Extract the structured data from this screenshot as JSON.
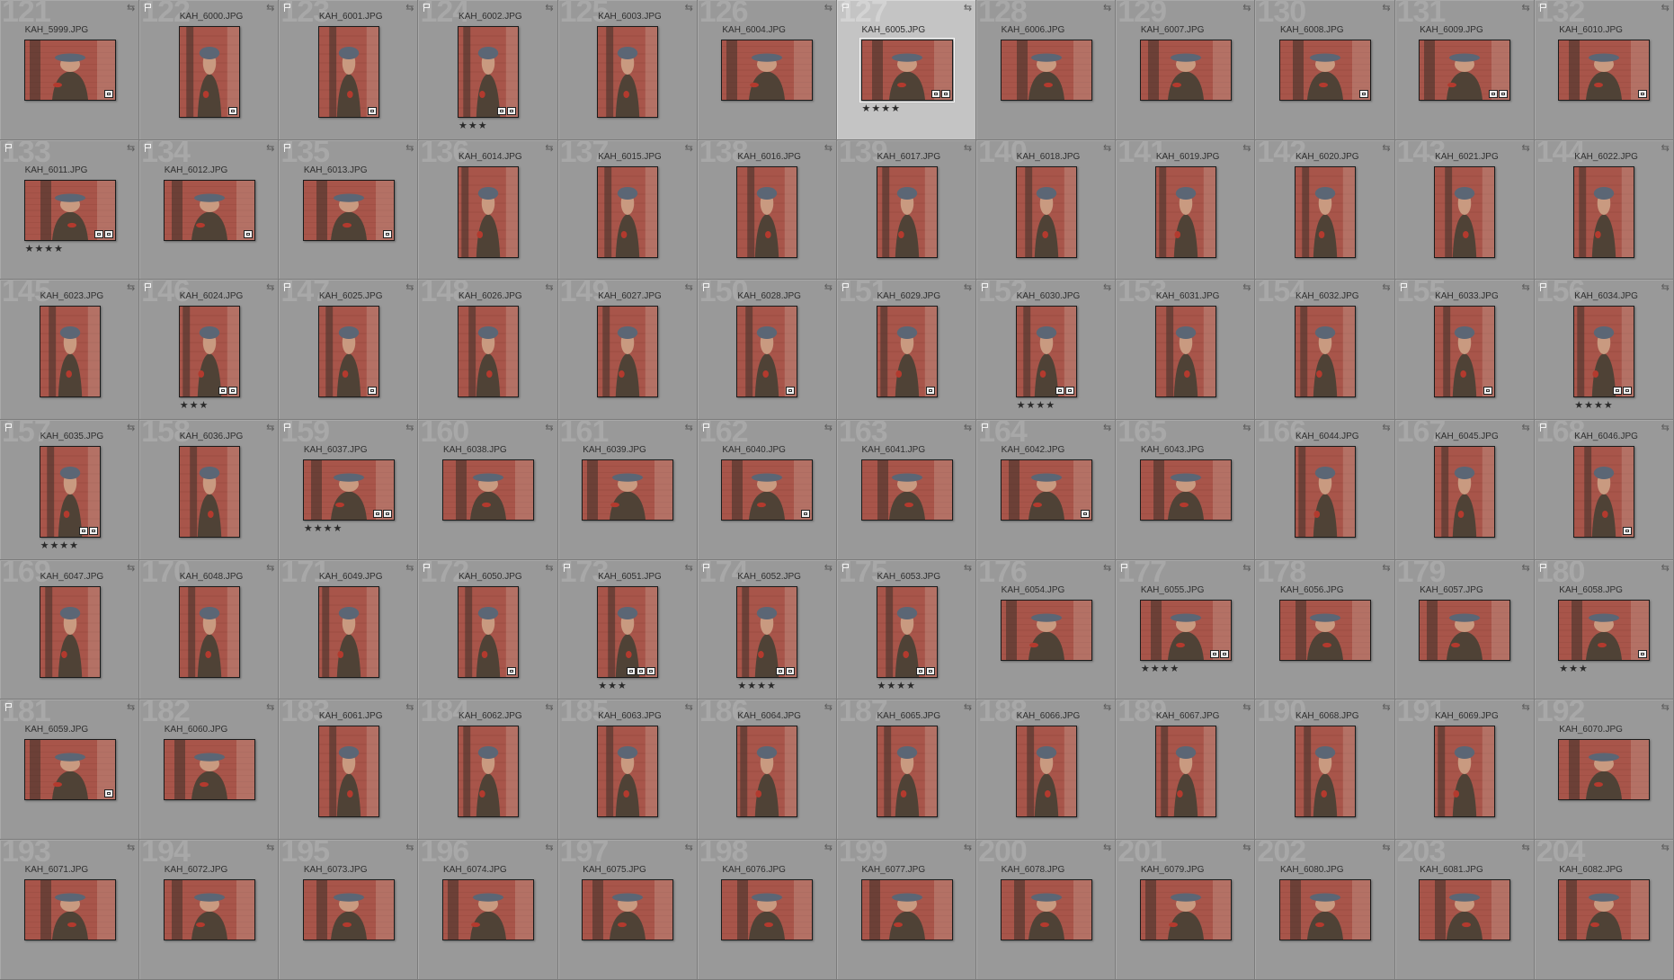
{
  "grid": {
    "cells": [
      {
        "index": "121",
        "filename": "KAH_5999.JPG",
        "flagged": false,
        "orientation": "landscape",
        "stars": "",
        "badges": 1,
        "selected": false
      },
      {
        "index": "122",
        "filename": "KAH_6000.JPG",
        "flagged": true,
        "orientation": "portrait",
        "stars": "",
        "badges": 1,
        "selected": false
      },
      {
        "index": "123",
        "filename": "KAH_6001.JPG",
        "flagged": true,
        "orientation": "portrait",
        "stars": "",
        "badges": 1,
        "selected": false
      },
      {
        "index": "124",
        "filename": "KAH_6002.JPG",
        "flagged": true,
        "orientation": "portrait",
        "stars": "★★★",
        "badges": 2,
        "selected": false
      },
      {
        "index": "125",
        "filename": "KAH_6003.JPG",
        "flagged": false,
        "orientation": "portrait",
        "stars": "",
        "badges": 0,
        "selected": false
      },
      {
        "index": "126",
        "filename": "KAH_6004.JPG",
        "flagged": false,
        "orientation": "landscape",
        "stars": "",
        "badges": 0,
        "selected": false
      },
      {
        "index": "127",
        "filename": "KAH_6005.JPG",
        "flagged": true,
        "orientation": "landscape",
        "stars": "★★★★",
        "badges": 2,
        "selected": true
      },
      {
        "index": "128",
        "filename": "KAH_6006.JPG",
        "flagged": false,
        "orientation": "landscape",
        "stars": "",
        "badges": 0,
        "selected": false
      },
      {
        "index": "129",
        "filename": "KAH_6007.JPG",
        "flagged": false,
        "orientation": "landscape",
        "stars": "",
        "badges": 0,
        "selected": false
      },
      {
        "index": "130",
        "filename": "KAH_6008.JPG",
        "flagged": false,
        "orientation": "landscape",
        "stars": "",
        "badges": 1,
        "selected": false
      },
      {
        "index": "131",
        "filename": "KAH_6009.JPG",
        "flagged": false,
        "orientation": "landscape",
        "stars": "",
        "badges": 2,
        "selected": false
      },
      {
        "index": "132",
        "filename": "KAH_6010.JPG",
        "flagged": true,
        "orientation": "landscape",
        "stars": "",
        "badges": 1,
        "selected": false
      },
      {
        "index": "133",
        "filename": "KAH_6011.JPG",
        "flagged": true,
        "orientation": "landscape",
        "stars": "★★★★",
        "badges": 2,
        "selected": false
      },
      {
        "index": "134",
        "filename": "KAH_6012.JPG",
        "flagged": true,
        "orientation": "landscape",
        "stars": "",
        "badges": 1,
        "selected": false
      },
      {
        "index": "135",
        "filename": "KAH_6013.JPG",
        "flagged": true,
        "orientation": "landscape",
        "stars": "",
        "badges": 1,
        "selected": false
      },
      {
        "index": "136",
        "filename": "KAH_6014.JPG",
        "flagged": false,
        "orientation": "portrait",
        "stars": "",
        "badges": 0,
        "selected": false
      },
      {
        "index": "137",
        "filename": "KAH_6015.JPG",
        "flagged": false,
        "orientation": "portrait",
        "stars": "",
        "badges": 0,
        "selected": false
      },
      {
        "index": "138",
        "filename": "KAH_6016.JPG",
        "flagged": false,
        "orientation": "portrait",
        "stars": "",
        "badges": 0,
        "selected": false
      },
      {
        "index": "139",
        "filename": "KAH_6017.JPG",
        "flagged": false,
        "orientation": "portrait",
        "stars": "",
        "badges": 0,
        "selected": false
      },
      {
        "index": "140",
        "filename": "KAH_6018.JPG",
        "flagged": false,
        "orientation": "portrait",
        "stars": "",
        "badges": 0,
        "selected": false
      },
      {
        "index": "141",
        "filename": "KAH_6019.JPG",
        "flagged": false,
        "orientation": "portrait",
        "stars": "",
        "badges": 0,
        "selected": false
      },
      {
        "index": "142",
        "filename": "KAH_6020.JPG",
        "flagged": false,
        "orientation": "portrait",
        "stars": "",
        "badges": 0,
        "selected": false
      },
      {
        "index": "143",
        "filename": "KAH_6021.JPG",
        "flagged": false,
        "orientation": "portrait",
        "stars": "",
        "badges": 0,
        "selected": false
      },
      {
        "index": "144",
        "filename": "KAH_6022.JPG",
        "flagged": false,
        "orientation": "portrait",
        "stars": "",
        "badges": 0,
        "selected": false
      },
      {
        "index": "145",
        "filename": "KAH_6023.JPG",
        "flagged": false,
        "orientation": "portrait",
        "stars": "",
        "badges": 0,
        "selected": false
      },
      {
        "index": "146",
        "filename": "KAH_6024.JPG",
        "flagged": true,
        "orientation": "portrait",
        "stars": "★★★",
        "badges": 2,
        "selected": false
      },
      {
        "index": "147",
        "filename": "KAH_6025.JPG",
        "flagged": true,
        "orientation": "portrait",
        "stars": "",
        "badges": 1,
        "selected": false
      },
      {
        "index": "148",
        "filename": "KAH_6026.JPG",
        "flagged": false,
        "orientation": "portrait",
        "stars": "",
        "badges": 0,
        "selected": false
      },
      {
        "index": "149",
        "filename": "KAH_6027.JPG",
        "flagged": false,
        "orientation": "portrait",
        "stars": "",
        "badges": 0,
        "selected": false
      },
      {
        "index": "150",
        "filename": "KAH_6028.JPG",
        "flagged": true,
        "orientation": "portrait",
        "stars": "",
        "badges": 1,
        "selected": false
      },
      {
        "index": "151",
        "filename": "KAH_6029.JPG",
        "flagged": true,
        "orientation": "portrait",
        "stars": "",
        "badges": 1,
        "selected": false
      },
      {
        "index": "152",
        "filename": "KAH_6030.JPG",
        "flagged": true,
        "orientation": "portrait",
        "stars": "★★★★",
        "badges": 2,
        "selected": false
      },
      {
        "index": "153",
        "filename": "KAH_6031.JPG",
        "flagged": false,
        "orientation": "portrait",
        "stars": "",
        "badges": 0,
        "selected": false
      },
      {
        "index": "154",
        "filename": "KAH_6032.JPG",
        "flagged": false,
        "orientation": "portrait",
        "stars": "",
        "badges": 0,
        "selected": false
      },
      {
        "index": "155",
        "filename": "KAH_6033.JPG",
        "flagged": true,
        "orientation": "portrait",
        "stars": "",
        "badges": 1,
        "selected": false
      },
      {
        "index": "156",
        "filename": "KAH_6034.JPG",
        "flagged": true,
        "orientation": "portrait",
        "stars": "★★★★",
        "badges": 2,
        "selected": false
      },
      {
        "index": "157",
        "filename": "KAH_6035.JPG",
        "flagged": true,
        "orientation": "portrait",
        "stars": "★★★★",
        "badges": 2,
        "selected": false
      },
      {
        "index": "158",
        "filename": "KAH_6036.JPG",
        "flagged": false,
        "orientation": "portrait",
        "stars": "",
        "badges": 0,
        "selected": false
      },
      {
        "index": "159",
        "filename": "KAH_6037.JPG",
        "flagged": true,
        "orientation": "landscape",
        "stars": "★★★★",
        "badges": 2,
        "selected": false
      },
      {
        "index": "160",
        "filename": "KAH_6038.JPG",
        "flagged": false,
        "orientation": "landscape",
        "stars": "",
        "badges": 0,
        "selected": false
      },
      {
        "index": "161",
        "filename": "KAH_6039.JPG",
        "flagged": false,
        "orientation": "landscape",
        "stars": "",
        "badges": 0,
        "selected": false
      },
      {
        "index": "162",
        "filename": "KAH_6040.JPG",
        "flagged": true,
        "orientation": "landscape",
        "stars": "",
        "badges": 1,
        "selected": false
      },
      {
        "index": "163",
        "filename": "KAH_6041.JPG",
        "flagged": false,
        "orientation": "landscape",
        "stars": "",
        "badges": 0,
        "selected": false
      },
      {
        "index": "164",
        "filename": "KAH_6042.JPG",
        "flagged": true,
        "orientation": "landscape",
        "stars": "",
        "badges": 1,
        "selected": false
      },
      {
        "index": "165",
        "filename": "KAH_6043.JPG",
        "flagged": false,
        "orientation": "landscape",
        "stars": "",
        "badges": 0,
        "selected": false
      },
      {
        "index": "166",
        "filename": "KAH_6044.JPG",
        "flagged": false,
        "orientation": "portrait",
        "stars": "",
        "badges": 0,
        "selected": false
      },
      {
        "index": "167",
        "filename": "KAH_6045.JPG",
        "flagged": false,
        "orientation": "portrait",
        "stars": "",
        "badges": 0,
        "selected": false
      },
      {
        "index": "168",
        "filename": "KAH_6046.JPG",
        "flagged": true,
        "orientation": "portrait",
        "stars": "",
        "badges": 1,
        "selected": false
      },
      {
        "index": "169",
        "filename": "KAH_6047.JPG",
        "flagged": false,
        "orientation": "portrait",
        "stars": "",
        "badges": 0,
        "selected": false
      },
      {
        "index": "170",
        "filename": "KAH_6048.JPG",
        "flagged": false,
        "orientation": "portrait",
        "stars": "",
        "badges": 0,
        "selected": false
      },
      {
        "index": "171",
        "filename": "KAH_6049.JPG",
        "flagged": false,
        "orientation": "portrait",
        "stars": "",
        "badges": 0,
        "selected": false
      },
      {
        "index": "172",
        "filename": "KAH_6050.JPG",
        "flagged": true,
        "orientation": "portrait",
        "stars": "",
        "badges": 1,
        "selected": false
      },
      {
        "index": "173",
        "filename": "KAH_6051.JPG",
        "flagged": true,
        "orientation": "portrait",
        "stars": "★★★",
        "badges": 3,
        "selected": false
      },
      {
        "index": "174",
        "filename": "KAH_6052.JPG",
        "flagged": true,
        "orientation": "portrait",
        "stars": "★★★★",
        "badges": 2,
        "selected": false
      },
      {
        "index": "175",
        "filename": "KAH_6053.JPG",
        "flagged": true,
        "orientation": "portrait",
        "stars": "★★★★",
        "badges": 2,
        "selected": false
      },
      {
        "index": "176",
        "filename": "KAH_6054.JPG",
        "flagged": false,
        "orientation": "landscape",
        "stars": "",
        "badges": 0,
        "selected": false
      },
      {
        "index": "177",
        "filename": "KAH_6055.JPG",
        "flagged": true,
        "orientation": "landscape",
        "stars": "★★★★",
        "badges": 2,
        "selected": false
      },
      {
        "index": "178",
        "filename": "KAH_6056.JPG",
        "flagged": false,
        "orientation": "landscape",
        "stars": "",
        "badges": 0,
        "selected": false
      },
      {
        "index": "179",
        "filename": "KAH_6057.JPG",
        "flagged": false,
        "orientation": "landscape",
        "stars": "",
        "badges": 0,
        "selected": false
      },
      {
        "index": "180",
        "filename": "KAH_6058.JPG",
        "flagged": true,
        "orientation": "landscape",
        "stars": "★★★",
        "badges": 1,
        "selected": false
      },
      {
        "index": "181",
        "filename": "KAH_6059.JPG",
        "flagged": true,
        "orientation": "landscape",
        "stars": "",
        "badges": 1,
        "selected": false
      },
      {
        "index": "182",
        "filename": "KAH_6060.JPG",
        "flagged": false,
        "orientation": "landscape",
        "stars": "",
        "badges": 0,
        "selected": false
      },
      {
        "index": "183",
        "filename": "KAH_6061.JPG",
        "flagged": false,
        "orientation": "portrait",
        "stars": "",
        "badges": 0,
        "selected": false
      },
      {
        "index": "184",
        "filename": "KAH_6062.JPG",
        "flagged": false,
        "orientation": "portrait",
        "stars": "",
        "badges": 0,
        "selected": false
      },
      {
        "index": "185",
        "filename": "KAH_6063.JPG",
        "flagged": false,
        "orientation": "portrait",
        "stars": "",
        "badges": 0,
        "selected": false
      },
      {
        "index": "186",
        "filename": "KAH_6064.JPG",
        "flagged": false,
        "orientation": "portrait",
        "stars": "",
        "badges": 0,
        "selected": false
      },
      {
        "index": "187",
        "filename": "KAH_6065.JPG",
        "flagged": false,
        "orientation": "portrait",
        "stars": "",
        "badges": 0,
        "selected": false
      },
      {
        "index": "188",
        "filename": "KAH_6066.JPG",
        "flagged": false,
        "orientation": "portrait",
        "stars": "",
        "badges": 0,
        "selected": false
      },
      {
        "index": "189",
        "filename": "KAH_6067.JPG",
        "flagged": false,
        "orientation": "portrait",
        "stars": "",
        "badges": 0,
        "selected": false
      },
      {
        "index": "190",
        "filename": "KAH_6068.JPG",
        "flagged": false,
        "orientation": "portrait",
        "stars": "",
        "badges": 0,
        "selected": false
      },
      {
        "index": "191",
        "filename": "KAH_6069.JPG",
        "flagged": false,
        "orientation": "portrait",
        "stars": "",
        "badges": 0,
        "selected": false
      },
      {
        "index": "192",
        "filename": "KAH_6070.JPG",
        "flagged": false,
        "orientation": "landscape",
        "stars": "",
        "badges": 0,
        "selected": false
      },
      {
        "index": "193",
        "filename": "KAH_6071.JPG",
        "flagged": false,
        "orientation": "landscape",
        "stars": "",
        "badges": 0,
        "selected": false
      },
      {
        "index": "194",
        "filename": "KAH_6072.JPG",
        "flagged": false,
        "orientation": "landscape",
        "stars": "",
        "badges": 0,
        "selected": false
      },
      {
        "index": "195",
        "filename": "KAH_6073.JPG",
        "flagged": false,
        "orientation": "landscape",
        "stars": "",
        "badges": 0,
        "selected": false
      },
      {
        "index": "196",
        "filename": "KAH_6074.JPG",
        "flagged": false,
        "orientation": "landscape",
        "stars": "",
        "badges": 0,
        "selected": false
      },
      {
        "index": "197",
        "filename": "KAH_6075.JPG",
        "flagged": false,
        "orientation": "landscape",
        "stars": "",
        "badges": 0,
        "selected": false
      },
      {
        "index": "198",
        "filename": "KAH_6076.JPG",
        "flagged": false,
        "orientation": "landscape",
        "stars": "",
        "badges": 0,
        "selected": false
      },
      {
        "index": "199",
        "filename": "KAH_6077.JPG",
        "flagged": false,
        "orientation": "landscape",
        "stars": "",
        "badges": 0,
        "selected": false
      },
      {
        "index": "200",
        "filename": "KAH_6078.JPG",
        "flagged": false,
        "orientation": "landscape",
        "stars": "",
        "badges": 0,
        "selected": false
      },
      {
        "index": "201",
        "filename": "KAH_6079.JPG",
        "flagged": false,
        "orientation": "landscape",
        "stars": "",
        "badges": 0,
        "selected": false
      },
      {
        "index": "202",
        "filename": "KAH_6080.JPG",
        "flagged": false,
        "orientation": "landscape",
        "stars": "",
        "badges": 0,
        "selected": false
      },
      {
        "index": "203",
        "filename": "KAH_6081.JPG",
        "flagged": false,
        "orientation": "landscape",
        "stars": "",
        "badges": 0,
        "selected": false
      },
      {
        "index": "204",
        "filename": "KAH_6082.JPG",
        "flagged": false,
        "orientation": "landscape",
        "stars": "",
        "badges": 0,
        "selected": false
      }
    ]
  },
  "colors": {
    "cell_bg": "#999999",
    "selected_cell_bg": "#c4c4c4",
    "brick": "#a8554a",
    "coat": "#4f4236",
    "hat": "#5b6675",
    "glove": "#b33a2e"
  },
  "icons": {
    "flag": "flag-icon",
    "rotate": "rotate-icon",
    "badge": "thumbnail-badge-icon"
  }
}
